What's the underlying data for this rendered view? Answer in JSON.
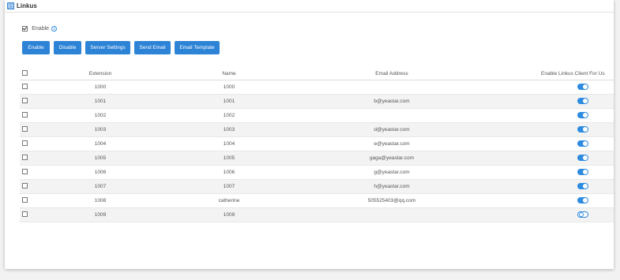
{
  "panel": {
    "title": "Linkus",
    "enable_label": "Enable",
    "enable_checked": true
  },
  "buttons": [
    "Enable",
    "Disable",
    "Server Settings",
    "Send Email",
    "Email Template"
  ],
  "table": {
    "headers": {
      "extension": "Extension",
      "name": "Name",
      "email": "Email Address",
      "client": "Enable Linkus Client For Us"
    },
    "rows": [
      {
        "extension": "1000",
        "name": "1000",
        "email": "",
        "enabled": true
      },
      {
        "extension": "1001",
        "name": "1001",
        "email": "b@yeastar.com",
        "enabled": true
      },
      {
        "extension": "1002",
        "name": "1002",
        "email": "",
        "enabled": true
      },
      {
        "extension": "1003",
        "name": "1003",
        "email": "d@yeastar.com",
        "enabled": true
      },
      {
        "extension": "1004",
        "name": "1004",
        "email": "e@yeastar.com",
        "enabled": true
      },
      {
        "extension": "1005",
        "name": "1005",
        "email": "gaga@yeastar.com",
        "enabled": true
      },
      {
        "extension": "1006",
        "name": "1006",
        "email": "g@yeastar.com",
        "enabled": true
      },
      {
        "extension": "1007",
        "name": "1007",
        "email": "h@yeastar.com",
        "enabled": true
      },
      {
        "extension": "1008",
        "name": "catherine",
        "email": "505525403@qq.com",
        "enabled": true
      },
      {
        "extension": "1009",
        "name": "1009",
        "email": "",
        "enabled": false
      }
    ]
  },
  "colors": {
    "accent": "#2d83d6",
    "toggle_on": "#2d8be0"
  }
}
